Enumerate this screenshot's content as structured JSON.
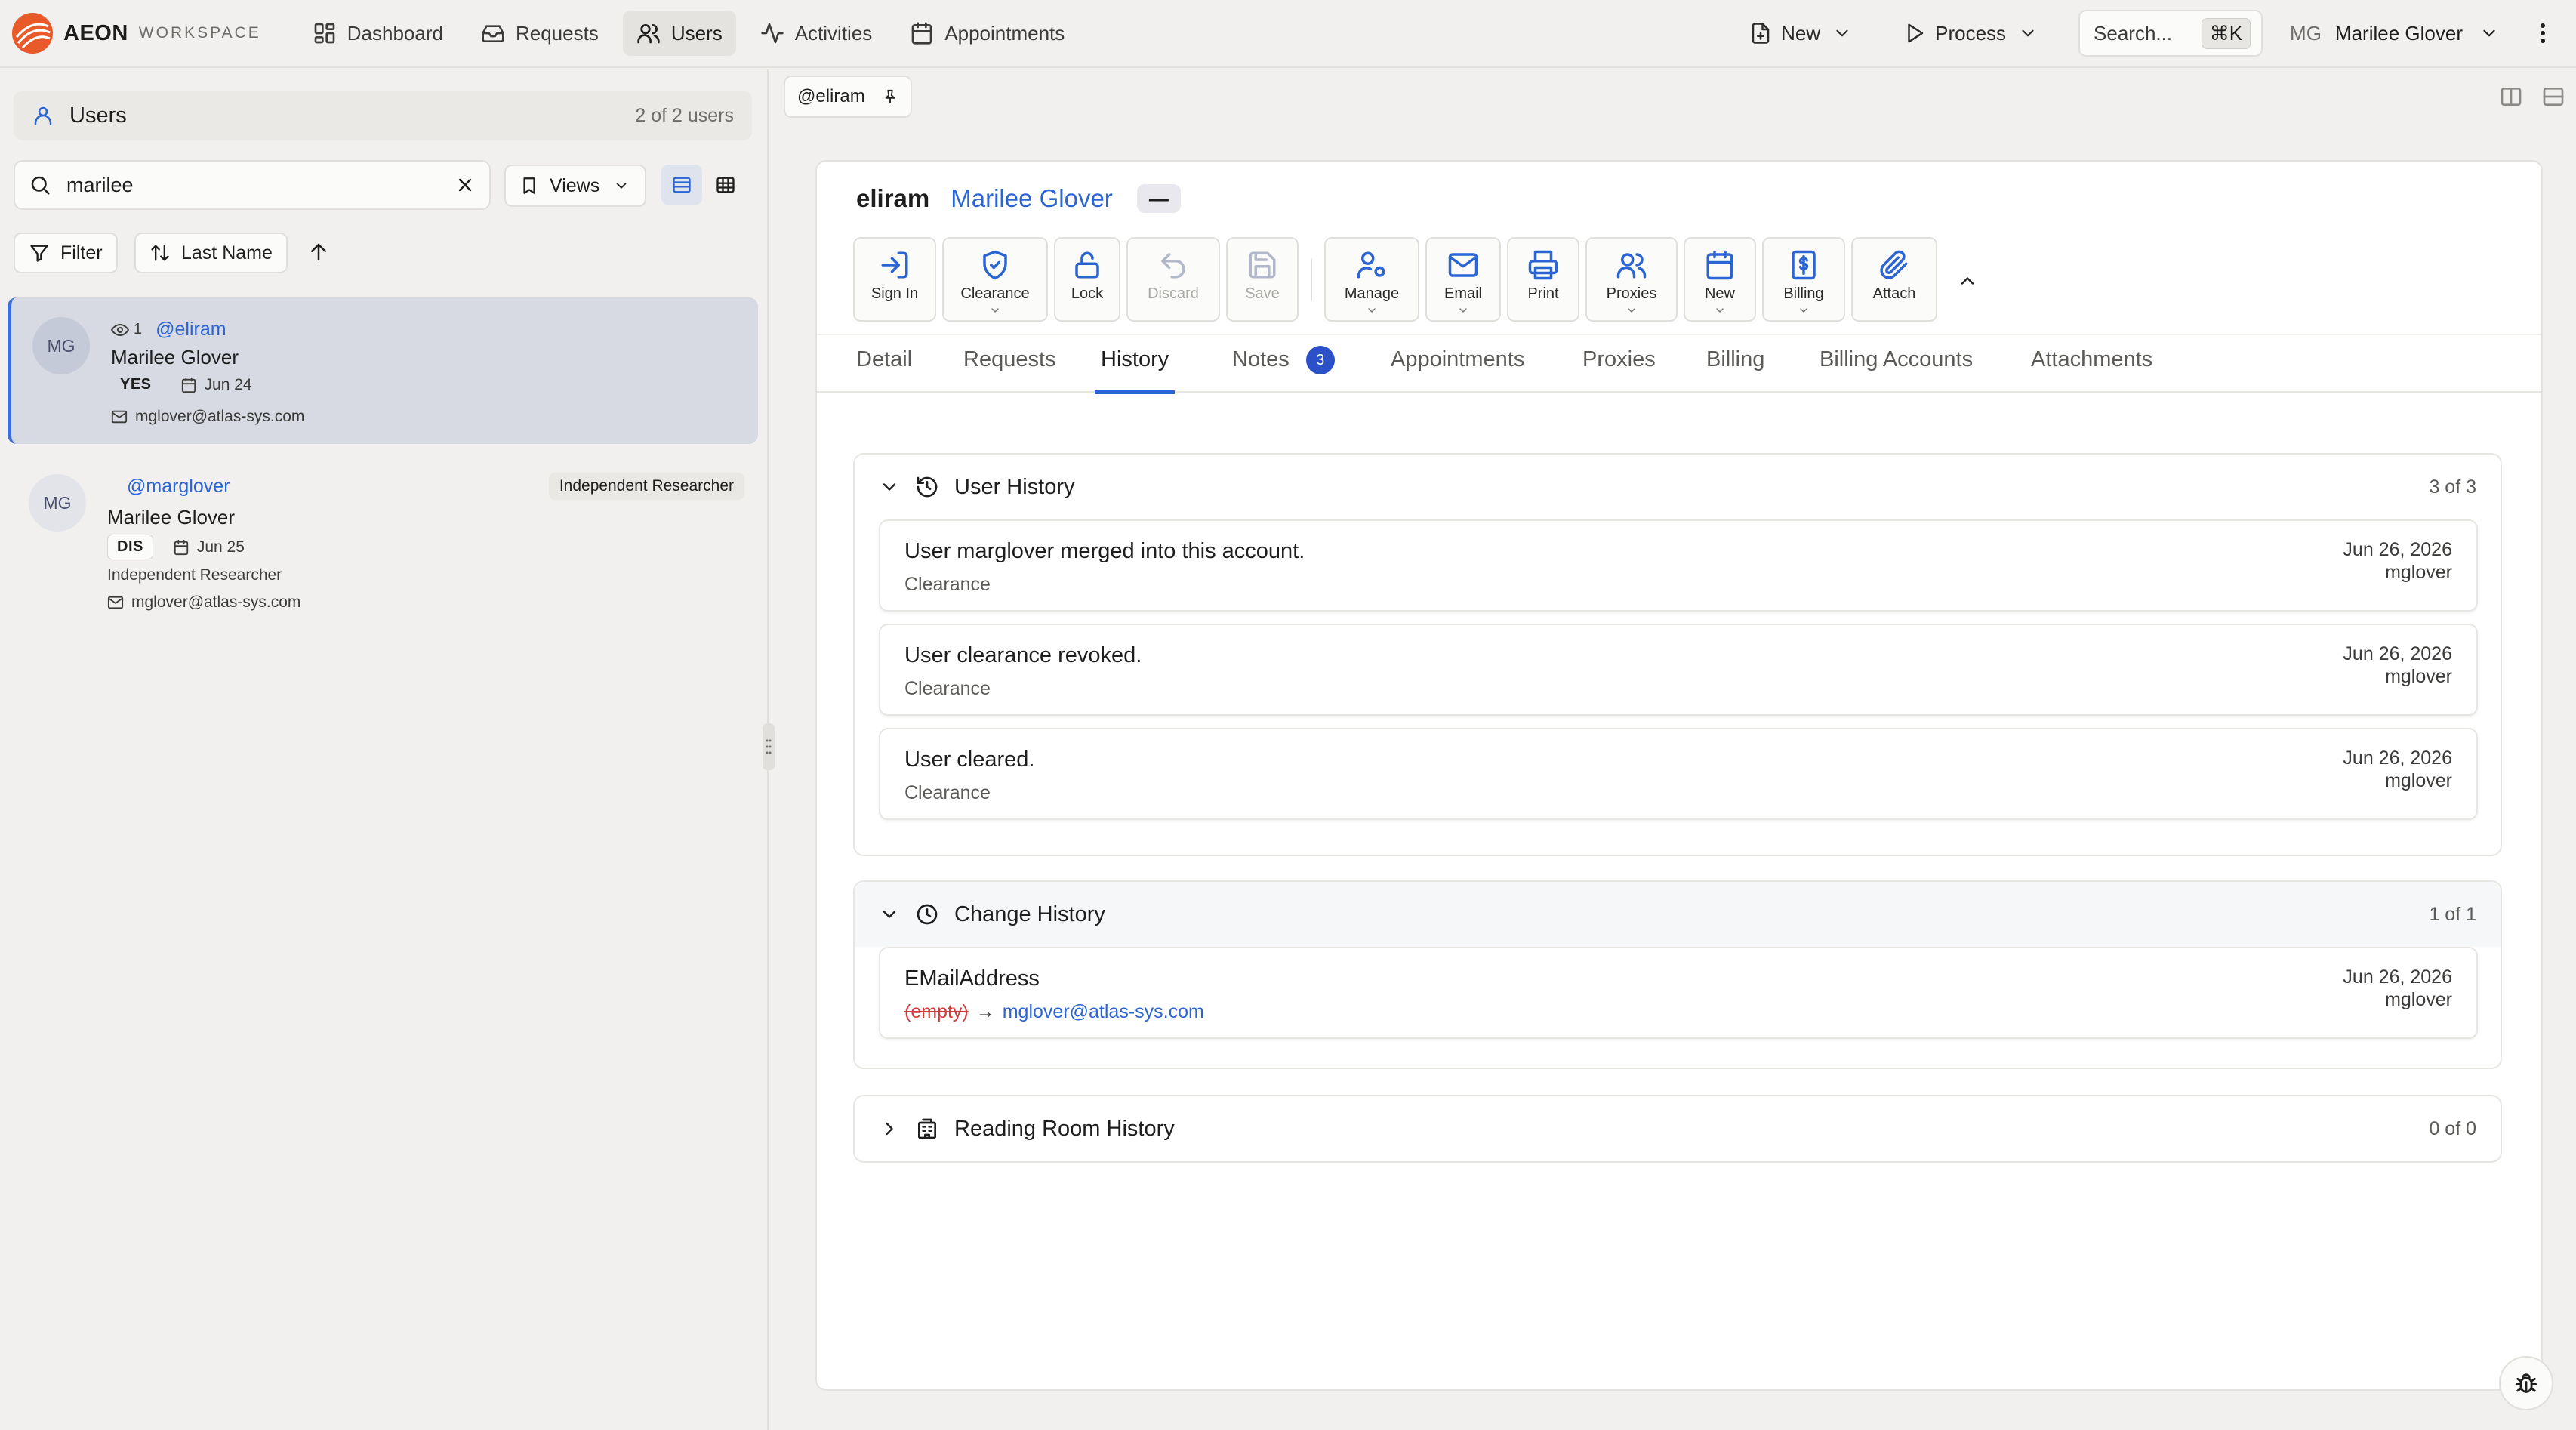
{
  "app": {
    "name": "AEON",
    "subtitle": "WORKSPACE",
    "accent": "#2b64d3"
  },
  "nav": {
    "tabs": [
      {
        "label": "Dashboard",
        "icon": "grid-icon"
      },
      {
        "label": "Requests",
        "icon": "inbox-icon"
      },
      {
        "label": "Users",
        "icon": "users-icon",
        "active": true
      },
      {
        "label": "Activities",
        "icon": "activity-icon"
      },
      {
        "label": "Appointments",
        "icon": "calendar-icon"
      }
    ],
    "new_label": "New",
    "process_label": "Process",
    "search_placeholder": "Search...",
    "search_shortcut": "⌘K",
    "user_initials": "MG",
    "user_name": "Marilee Glover"
  },
  "left": {
    "title": "Users",
    "count": "2 of 2 users",
    "search_value": "marilee",
    "views_label": "Views",
    "filter_label": "Filter",
    "sort_label": "Last Name",
    "users": [
      {
        "initials": "MG",
        "views": "1",
        "handle": "@eliram",
        "name": "Marilee Glover",
        "status": "YES",
        "date": "Jun 24",
        "email": "mglover@atlas-sys.com",
        "selected": true
      },
      {
        "initials": "MG",
        "handle": "@marglover",
        "name": "Marilee Glover",
        "status": "DIS",
        "date": "Jun 25",
        "type": "Independent Researcher",
        "email": "mglover@atlas-sys.com",
        "tag": "Independent Researcher"
      }
    ]
  },
  "tabstrip": {
    "label": "@eliram"
  },
  "record": {
    "handle": "eliram",
    "name": "Marilee Glover",
    "pill": "—",
    "toolbar": [
      {
        "label": "Sign In",
        "icon": "sign-in-icon"
      },
      {
        "label": "Clearance",
        "icon": "shield-check-icon"
      },
      {
        "label": "Lock",
        "icon": "lock-icon"
      },
      {
        "label": "Discard",
        "icon": "undo-icon"
      },
      {
        "label": "Save",
        "icon": "save-icon"
      },
      {
        "label": "Manage",
        "icon": "user-cog-icon"
      },
      {
        "label": "Email",
        "icon": "mail-icon"
      },
      {
        "label": "Print",
        "icon": "printer-icon"
      },
      {
        "label": "Proxies",
        "icon": "users-icon"
      },
      {
        "label": "New",
        "icon": "calendar-icon"
      },
      {
        "label": "Billing",
        "icon": "dollar-receipt-icon"
      },
      {
        "label": "Attach",
        "icon": "paperclip-icon"
      }
    ],
    "tabs": [
      {
        "label": "Detail"
      },
      {
        "label": "Requests"
      },
      {
        "label": "History",
        "active": true
      },
      {
        "label": "Notes",
        "badge": "3"
      },
      {
        "label": "Appointments"
      },
      {
        "label": "Proxies"
      },
      {
        "label": "Billing"
      },
      {
        "label": "Billing Accounts"
      },
      {
        "label": "Attachments"
      }
    ]
  },
  "history": {
    "user_history": {
      "title": "User History",
      "count": "3 of 3",
      "items": [
        {
          "title": "User marglover merged into this account.",
          "sub": "Clearance",
          "date": "Jun 26, 2026",
          "by": "mglover"
        },
        {
          "title": "User clearance revoked.",
          "sub": "Clearance",
          "date": "Jun 26, 2026",
          "by": "mglover"
        },
        {
          "title": "User cleared.",
          "sub": "Clearance",
          "date": "Jun 26, 2026",
          "by": "mglover"
        }
      ]
    },
    "change_history": {
      "title": "Change History",
      "count": "1 of 1",
      "items": [
        {
          "title": "EMailAddress",
          "old": "(empty)",
          "arrow": "→",
          "new": "mglover@atlas-sys.com",
          "date": "Jun 26, 2026",
          "by": "mglover"
        }
      ]
    },
    "reading_room": {
      "title": "Reading Room History",
      "count": "0 of 0"
    }
  }
}
